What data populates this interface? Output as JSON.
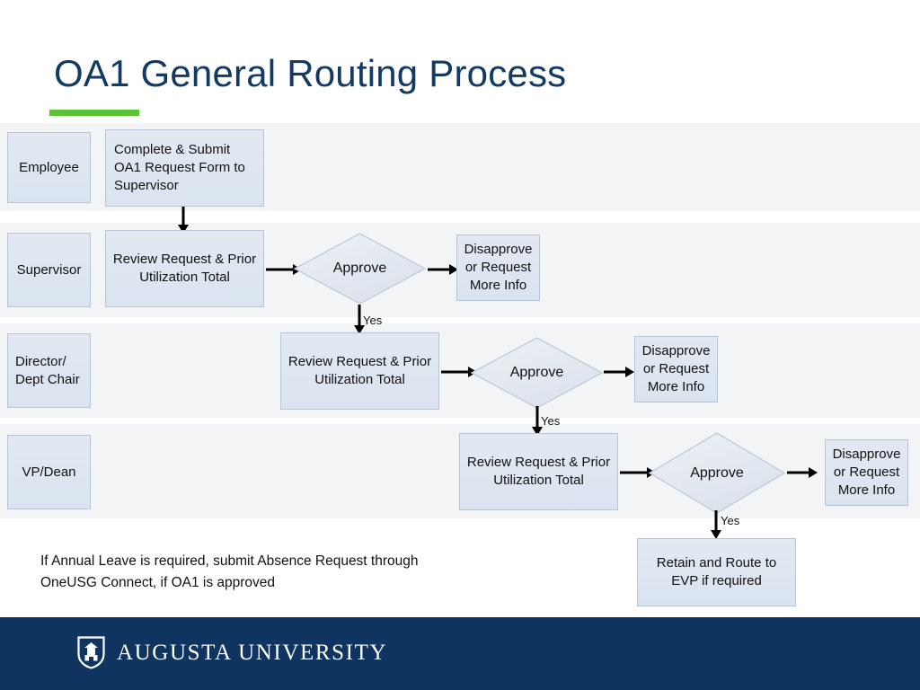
{
  "slide": {
    "title": "OA1 General Routing Process",
    "accent_color": "#5bc236",
    "title_color": "#123a63",
    "band_color": "#f2f4f6",
    "node_fill": "#dae3ef",
    "node_border": "#b6c4d6"
  },
  "lanes": [
    {
      "id": "employee",
      "label": "Employee"
    },
    {
      "id": "supervisor",
      "label": "Supervisor"
    },
    {
      "id": "director",
      "label": "Director/\nDept Chair"
    },
    {
      "id": "vpdean",
      "label": "VP/Dean"
    }
  ],
  "lane_labels": {
    "employee": "Employee",
    "supervisor": "Supervisor",
    "director_line1": "Director/",
    "director_line2": "Dept Chair",
    "vpdean": "VP/Dean"
  },
  "nodes": {
    "employee_submit": "Complete & Submit OA1 Request Form to Supervisor",
    "supervisor_review": "Review Request & Prior Utilization Total",
    "supervisor_decision": "Approve",
    "supervisor_reject": "Disapprove or Request More Info",
    "director_review": "Review Request & Prior Utilization Total",
    "director_decision": "Approve",
    "director_reject": "Disapprove or Request More Info",
    "vpdean_review": "Review Request & Prior Utilization Total",
    "vpdean_decision": "Approve",
    "vpdean_reject": "Disapprove or Request More Info",
    "final_retain": "Retain and Route to EVP if required"
  },
  "edge_labels": {
    "supervisor_yes": "Yes",
    "director_yes": "Yes",
    "vpdean_yes": "Yes",
    "final_yes": "Yes"
  },
  "footnote": {
    "line1": "If Annual Leave is required, submit Absence Request through",
    "line2": "OneUSG Connect, if OA1 is approved"
  },
  "footer": {
    "brand": "AUGUSTA UNIVERSITY",
    "bar_color": "#0f3460",
    "logo_icon": "shield-crest-icon"
  }
}
